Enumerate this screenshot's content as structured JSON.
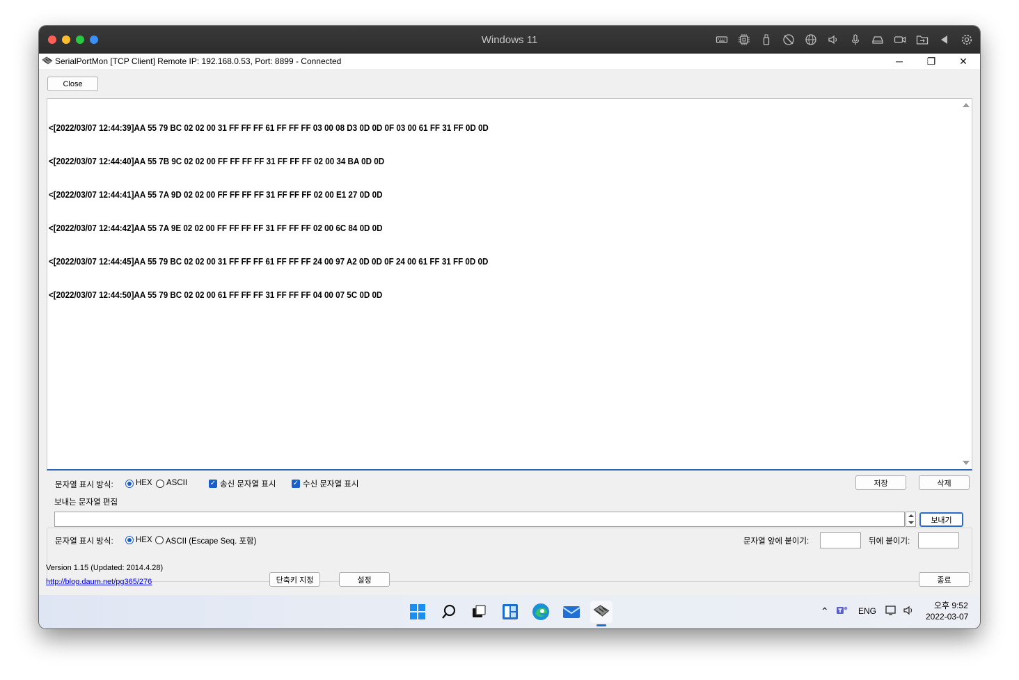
{
  "mac_window": {
    "title": "Windows 11",
    "traffic_colors": [
      "#ff5f57",
      "#febc2e",
      "#28c840",
      "#3b8ff6"
    ],
    "toolbar_icons": [
      "keyboard-icon",
      "cpu-icon",
      "usb-icon",
      "camera-off-icon",
      "globe-icon",
      "speaker-icon",
      "microphone-icon",
      "drive-icon",
      "camera-icon",
      "shared-folder-icon",
      "arrow-left-icon",
      "gear-icon"
    ]
  },
  "app_window": {
    "title": "SerialPortMon [TCP Client] Remote IP: 192.168.0.53, Port: 8899 - Connected",
    "minimize": "─",
    "restore": "❐",
    "close": "✕"
  },
  "toolbar": {
    "close_label": "Close"
  },
  "log": {
    "lines": [
      "<[2022/03/07 12:44:39]AA 55 79 BC 02 02 00 31 FF FF FF 61 FF FF FF 03 00 08 D3 0D 0D 0F 03 00 61 FF 31 FF 0D 0D",
      "<[2022/03/07 12:44:40]AA 55 7B 9C 02 02 00 FF FF FF FF 31 FF FF FF 02 00 34 BA 0D 0D",
      "<[2022/03/07 12:44:41]AA 55 7A 9D 02 02 00 FF FF FF FF 31 FF FF FF 02 00 E1 27 0D 0D",
      "<[2022/03/07 12:44:42]AA 55 7A 9E 02 02 00 FF FF FF FF 31 FF FF FF 02 00 6C 84 0D 0D",
      "<[2022/03/07 12:44:45]AA 55 79 BC 02 02 00 31 FF FF FF 61 FF FF FF 24 00 97 A2 0D 0D 0F 24 00 61 FF 31 FF 0D 0D",
      "<[2022/03/07 12:44:50]AA 55 79 BC 02 02 00 61 FF FF FF 31 FF FF FF 04 00 07 5C 0D 0D"
    ]
  },
  "display": {
    "mode_label": "문자열 표시 방식:",
    "hex_label": "HEX",
    "ascii_label": "ASCII",
    "selected_mode": "HEX",
    "show_sent_label": "송신 문자열 표시",
    "show_sent_checked": true,
    "show_recv_label": "수신 문자열 표시",
    "show_recv_checked": true,
    "save_label": "저장",
    "delete_label": "삭제"
  },
  "send_group": {
    "title": "보내는 문자열 편집",
    "input_value": "",
    "send_label": "보내기",
    "mode_label": "문자열 표시 방식:",
    "hex_label": "HEX",
    "ascii_label": "ASCII (Escape Seq. 포함)",
    "selected_mode": "HEX",
    "prefix_label": "문자열 앞에 붙이기:",
    "prefix_value": "",
    "suffix_label": "뒤에 붙이기:",
    "suffix_value": ""
  },
  "footer": {
    "version": "Version 1.15 (Updated: 2014.4.28)",
    "link": "http://blog.daum.net/pg365/276",
    "shortcut_label": "단축키 지정",
    "settings_label": "설정",
    "exit_label": "종료"
  },
  "taskbar": {
    "apps": [
      "windows-start-icon",
      "search-icon",
      "task-view-icon",
      "widgets-icon",
      "edge-icon",
      "mail-icon",
      "serialportmon-icon"
    ],
    "tray_lang": "ENG",
    "time": "오후 9:52",
    "date": "2022-03-07"
  }
}
